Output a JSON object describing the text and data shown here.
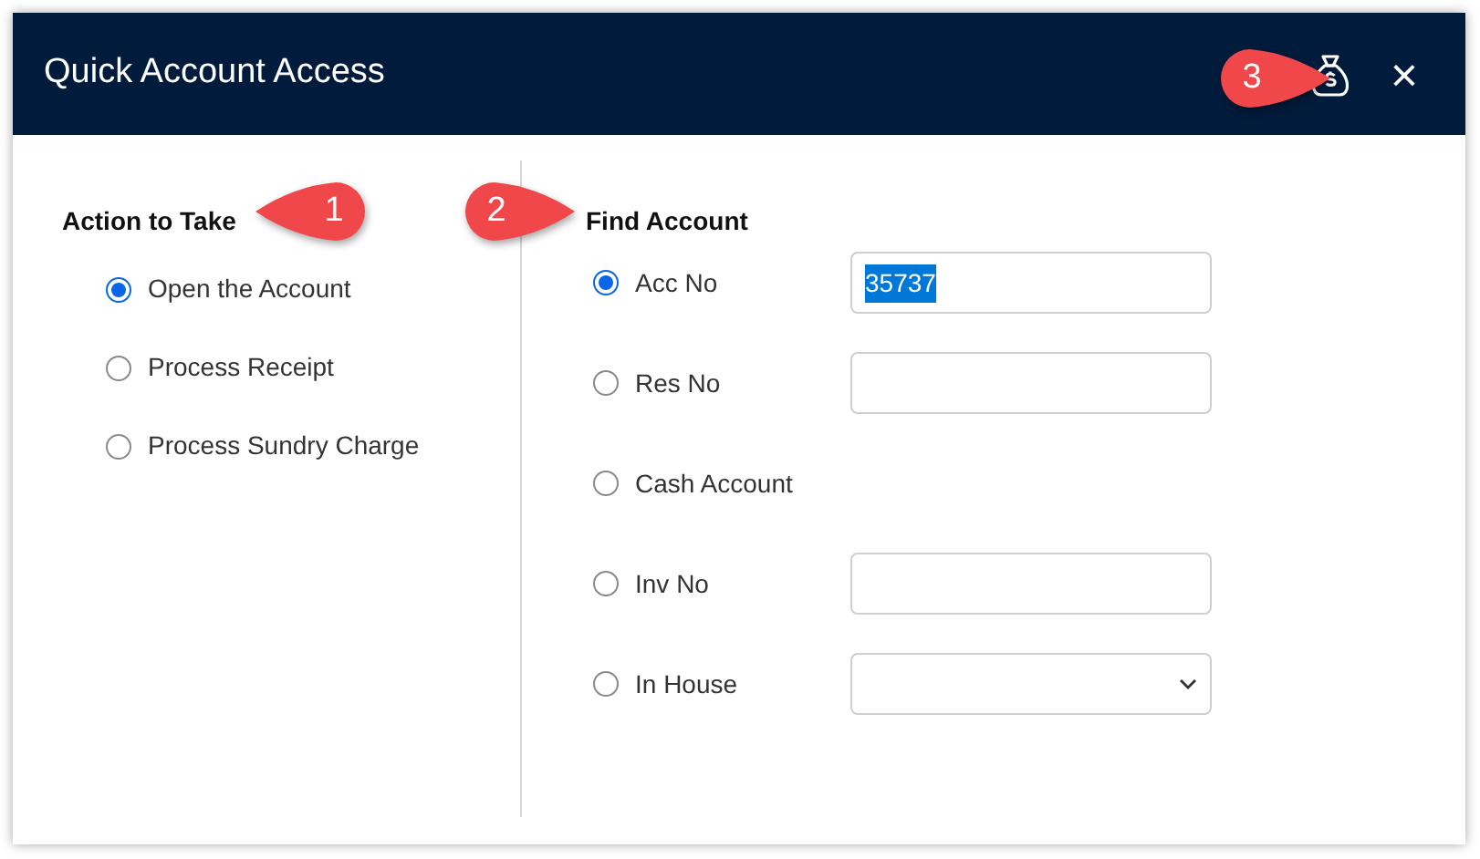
{
  "window": {
    "title": "Quick Account Access",
    "close": "×"
  },
  "callouts": [
    {
      "number": "1",
      "points_right": false
    },
    {
      "number": "2",
      "points_right": true
    },
    {
      "number": "3",
      "points_right": true
    }
  ],
  "action_to_take": {
    "heading": "Action to Take",
    "options": [
      {
        "label": "Open the Account",
        "selected": true
      },
      {
        "label": "Process Receipt",
        "selected": false
      },
      {
        "label": "Process Sundry Charge",
        "selected": false
      }
    ]
  },
  "find_account": {
    "heading": "Find Account",
    "options": [
      {
        "label": "Acc No",
        "selected": true,
        "kind": "text",
        "value": "35737",
        "text_selected": true
      },
      {
        "label": "Res No",
        "selected": false,
        "kind": "text"
      },
      {
        "label": "Cash Account",
        "selected": false,
        "kind": "none"
      },
      {
        "label": "Inv No",
        "selected": false,
        "kind": "text"
      },
      {
        "label": "In House",
        "selected": false,
        "kind": "dropdown"
      }
    ]
  }
}
